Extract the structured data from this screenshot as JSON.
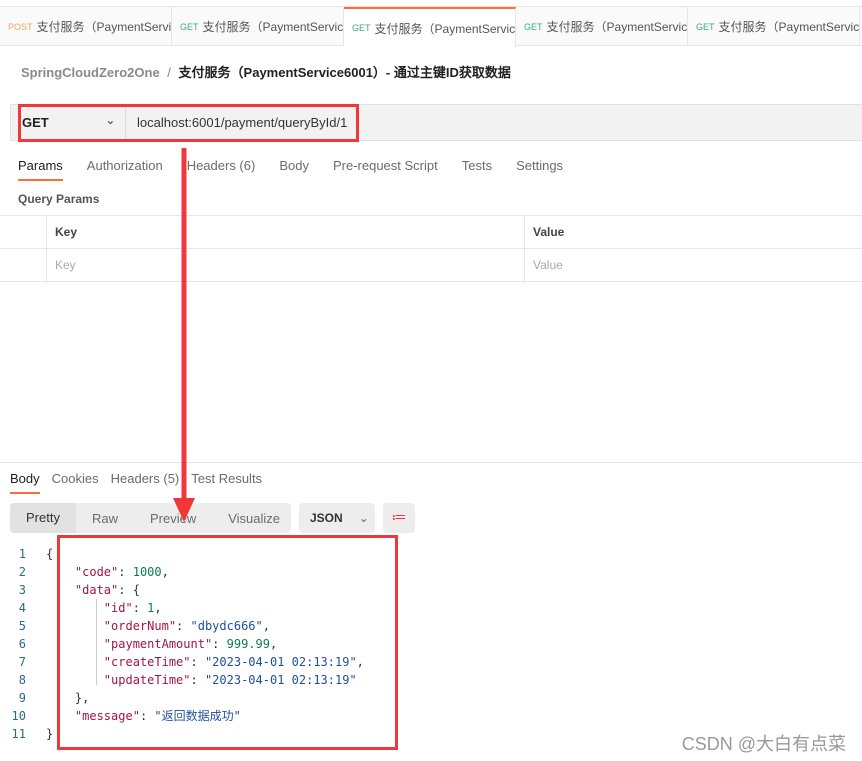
{
  "tabs": [
    {
      "method": "POST",
      "label": "支付服务（PaymentServi",
      "active": false
    },
    {
      "method": "GET",
      "label": "支付服务（PaymentServic",
      "active": false
    },
    {
      "method": "GET",
      "label": "支付服务（PaymentServic",
      "active": true
    },
    {
      "method": "GET",
      "label": "支付服务（PaymentServic",
      "active": false
    },
    {
      "method": "GET",
      "label": "支付服务（PaymentServic",
      "active": false
    }
  ],
  "breadcrumb": {
    "collection": "SpringCloudZero2One",
    "sep": "/",
    "request": "支付服务（PaymentService6001）- 通过主键ID获取数据"
  },
  "request": {
    "method": "GET",
    "url": "localhost:6001/payment/queryById/1"
  },
  "request_tabs": [
    "Params",
    "Authorization",
    "Headers (6)",
    "Body",
    "Pre-request Script",
    "Tests",
    "Settings"
  ],
  "query_params": {
    "title": "Query Params",
    "headers": [
      "Key",
      "Value"
    ],
    "placeholders": [
      "Key",
      "Value"
    ]
  },
  "response_tabs": [
    "Body",
    "Cookies",
    "Headers (5)",
    "Test Results"
  ],
  "view_modes": [
    "Pretty",
    "Raw",
    "Preview",
    "Visualize"
  ],
  "format": "JSON",
  "colors": {
    "accent": "#ff6c37",
    "annotation": "#f0383b"
  },
  "code_lines": [
    [
      [
        "{",
        "p"
      ]
    ],
    [
      [
        "    ",
        ""
      ],
      [
        "\"code\"",
        "k"
      ],
      [
        ": ",
        "p"
      ],
      [
        "1000",
        "n"
      ],
      [
        ",",
        "p"
      ]
    ],
    [
      [
        "    ",
        ""
      ],
      [
        "\"data\"",
        "k"
      ],
      [
        ": {",
        "p"
      ]
    ],
    [
      [
        "        ",
        ""
      ],
      [
        "\"id\"",
        "k"
      ],
      [
        ": ",
        "p"
      ],
      [
        "1",
        "n"
      ],
      [
        ",",
        "p"
      ]
    ],
    [
      [
        "        ",
        ""
      ],
      [
        "\"orderNum\"",
        "k"
      ],
      [
        ": ",
        "p"
      ],
      [
        "\"dbydc666\"",
        "s"
      ],
      [
        ",",
        "p"
      ]
    ],
    [
      [
        "        ",
        ""
      ],
      [
        "\"paymentAmount\"",
        "k"
      ],
      [
        ": ",
        "p"
      ],
      [
        "999.99",
        "n"
      ],
      [
        ",",
        "p"
      ]
    ],
    [
      [
        "        ",
        ""
      ],
      [
        "\"createTime\"",
        "k"
      ],
      [
        ": ",
        "p"
      ],
      [
        "\"2023-04-01 02:13:19\"",
        "s"
      ],
      [
        ",",
        "p"
      ]
    ],
    [
      [
        "        ",
        ""
      ],
      [
        "\"updateTime\"",
        "k"
      ],
      [
        ": ",
        "p"
      ],
      [
        "\"2023-04-01 02:13:19\"",
        "s"
      ]
    ],
    [
      [
        "    ",
        ""
      ],
      [
        "},",
        "p"
      ]
    ],
    [
      [
        "    ",
        ""
      ],
      [
        "\"message\"",
        "k"
      ],
      [
        ": ",
        "p"
      ],
      [
        "\"返回数据成功\"",
        "s"
      ]
    ],
    [
      [
        "}",
        "p"
      ]
    ]
  ],
  "watermark": "CSDN @大白有点菜"
}
